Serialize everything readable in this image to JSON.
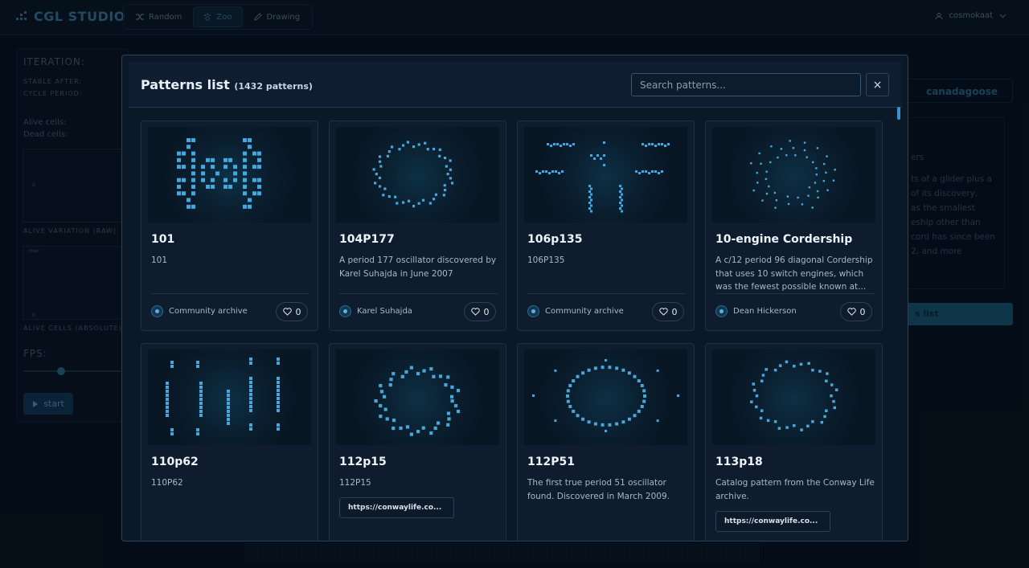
{
  "app": {
    "name": "CGL STUDIO",
    "user": "cosmokaat"
  },
  "nav": [
    {
      "label": "Random",
      "icon": "shuffle-icon",
      "active": false
    },
    {
      "label": "Zoo",
      "icon": "paw-icon",
      "active": true
    },
    {
      "label": "Drawing",
      "icon": "pencil-icon",
      "active": false
    }
  ],
  "background": {
    "iteration": "ITERATION:",
    "stable_after": "STABLE AFTER:",
    "cycle_period": "CYCLE PERIOD:",
    "alive_cells": "Alive cells:",
    "dead_cells": "Dead cells:",
    "chart1_label": "ALIVE VARIATION (RAW)",
    "chart2_label": "ALIVE CELLS (ABSOLUTE)",
    "chart_zero": "0",
    "chart_max": "max",
    "fps": "FPS:",
    "start": "start",
    "right_name": "canadagoose",
    "right_heading": "ers",
    "right_text": [
      "ts of a glider plus a",
      "of its discovery,",
      "as the smallest",
      "eship other than",
      "cord has since been",
      "2, and more"
    ],
    "right_button": "s list"
  },
  "modal": {
    "title": "Patterns list",
    "count": "(1432 patterns)",
    "search_placeholder": "Search patterns...",
    "close_label": "×"
  },
  "patterns": [
    {
      "name": "101",
      "desc": "101",
      "author": "Community archive",
      "likes": "0"
    },
    {
      "name": "104P177",
      "desc": "A period 177 oscillator discovered by Karel Suhajda in June 2007",
      "author": "Karel Suhajda",
      "likes": "0"
    },
    {
      "name": "106p135",
      "desc": "106P135",
      "author": "Community archive",
      "likes": "0"
    },
    {
      "name": "10-engine Cordership",
      "desc": "A c/12 period 96 diagonal Cordership that uses 10 switch engines, which was the fewest possible known at...",
      "author": "Dean Hickerson",
      "likes": "0"
    },
    {
      "name": "110p62",
      "desc": "110P62"
    },
    {
      "name": "112p15",
      "desc": "112P15",
      "link": "https://conwaylife.co..."
    },
    {
      "name": "112P51",
      "desc": "The first true period 51 oscillator found. Discovered in March 2009."
    },
    {
      "name": "113p18",
      "desc": "Catalog pattern from the Conway Life archive.",
      "link": "https://conwaylife.co..."
    }
  ],
  "colors": {
    "accent": "#3f7fa8",
    "cell": "#4aa5d8",
    "bg": "#07111e"
  }
}
